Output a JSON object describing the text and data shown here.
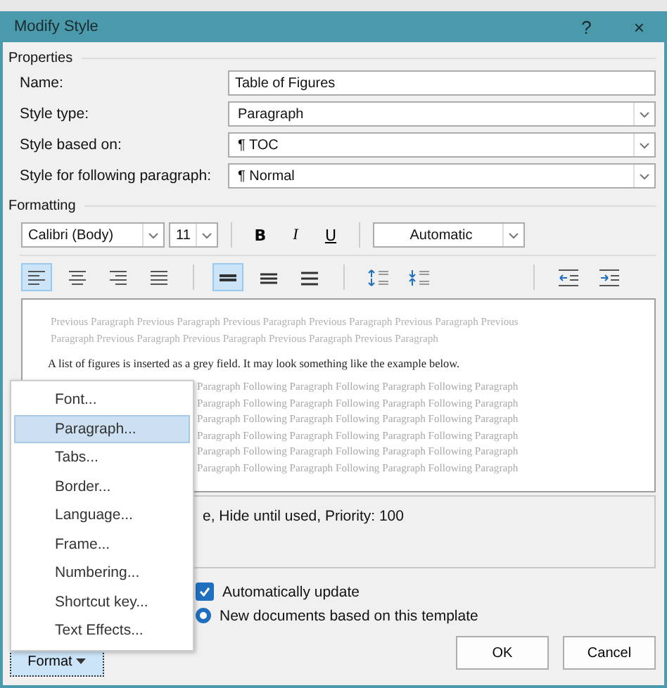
{
  "window": {
    "title": "Modify Style",
    "help": "?",
    "close": "×"
  },
  "properties": {
    "heading": "Properties",
    "rows": [
      {
        "label": "Name:",
        "kind": "text",
        "value": "Table of Figures"
      },
      {
        "label": "Style type:",
        "kind": "dropdown",
        "value": "Paragraph"
      },
      {
        "label": "Style based on:",
        "kind": "dropdown",
        "value": "¶ TOC"
      },
      {
        "label": "Style for following paragraph:",
        "kind": "dropdown",
        "value": "¶ Normal"
      }
    ]
  },
  "formatting": {
    "heading": "Formatting",
    "font": "Calibri (Body)",
    "size": "11",
    "styles": [
      {
        "label": "B",
        "kind": "bold",
        "selected": false
      },
      {
        "label": "I",
        "kind": "italic",
        "selected": false
      },
      {
        "label": "U",
        "kind": "underline",
        "selected": false
      }
    ],
    "font_color": "Automatic",
    "alignment": [
      {
        "kind": "left",
        "selected": true
      },
      {
        "kind": "center",
        "selected": false
      },
      {
        "kind": "right",
        "selected": false
      },
      {
        "kind": "justify",
        "selected": false
      }
    ],
    "spacing": [
      {
        "kind": "single",
        "selected": true
      },
      {
        "kind": "onehalf",
        "selected": false
      },
      {
        "kind": "double",
        "selected": false
      }
    ],
    "paragraph_spacing": [
      {
        "kind": "increase"
      },
      {
        "kind": "decrease"
      }
    ],
    "indent": [
      {
        "kind": "decrease"
      },
      {
        "kind": "increase"
      }
    ]
  },
  "preview": {
    "previous": [
      "Previous Paragraph Previous Paragraph Previous Paragraph Previous Paragraph Previous Paragraph Previous",
      "Paragraph Previous Paragraph Previous Paragraph Previous Paragraph Previous Paragraph"
    ],
    "sample": "A list of figures is inserted as a grey field. It may look something like the example below.",
    "following": [
      "Paragraph Following Paragraph Following Paragraph Following Paragraph",
      "Paragraph Following Paragraph Following Paragraph Following Paragraph",
      "Paragraph Following Paragraph Following Paragraph Following Paragraph",
      "Paragraph Following Paragraph Following Paragraph Following Paragraph",
      "Paragraph Following Paragraph Following Paragraph Following Paragraph",
      "Paragraph Following Paragraph Following Paragraph Following Paragraph"
    ]
  },
  "description": "e, Hide until used, Priority: 100",
  "options": [
    {
      "kind": "checkbox",
      "label": "Automatically update",
      "checked": true
    },
    {
      "kind": "radio",
      "label": "New documents based on this template",
      "selected": true
    }
  ],
  "format_menu": {
    "items": [
      {
        "label": "Font...",
        "selected": false
      },
      {
        "label": "Paragraph...",
        "selected": true
      },
      {
        "label": "Tabs...",
        "selected": false
      },
      {
        "label": "Border...",
        "selected": false
      },
      {
        "label": "Language...",
        "selected": false
      },
      {
        "label": "Frame...",
        "selected": false
      },
      {
        "label": "Numbering...",
        "selected": false
      },
      {
        "label": "Shortcut key...",
        "selected": false
      },
      {
        "label": "Text Effects...",
        "selected": false
      }
    ]
  },
  "buttons": {
    "format": "Format",
    "ok": "OK",
    "cancel": "Cancel"
  }
}
